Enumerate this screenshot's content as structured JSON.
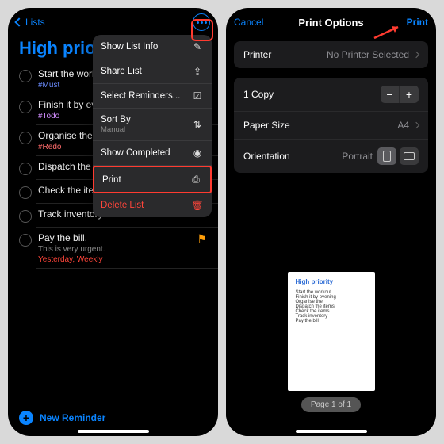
{
  "colors": {
    "accent": "#0a84ff",
    "destructive": "#ff453a",
    "flag": "#ff9f0a"
  },
  "left": {
    "nav": {
      "back": "Lists"
    },
    "list_title": "High priority",
    "reminders": [
      {
        "title": "Start the workout regime.",
        "tag": "#Must",
        "tag_color": "#6b8cff"
      },
      {
        "title": "Finish it by evening.",
        "tag": "#Todo",
        "tag_color": "#d38fff"
      },
      {
        "title": "Organise the drawer.",
        "tag": "#Redo",
        "tag_color": "#ff6b6b"
      },
      {
        "title": "Dispatch the items."
      },
      {
        "title": "Check the items."
      },
      {
        "title": "Track inventory"
      },
      {
        "title": "Pay the bill.",
        "subtitle": "This is very urgent.",
        "date": "Yesterday, Weekly",
        "date_color": "#ff453a",
        "flagged": true
      }
    ],
    "new_reminder": "New Reminder",
    "menu": {
      "show_info": "Show List Info",
      "share": "Share List",
      "select": "Select Reminders...",
      "sort_by": "Sort By",
      "sort_by_sub": "Manual",
      "show_completed": "Show Completed",
      "print": "Print",
      "delete": "Delete List"
    }
  },
  "right": {
    "nav": {
      "cancel": "Cancel",
      "title": "Print Options",
      "print": "Print"
    },
    "printer": {
      "label": "Printer",
      "value": "No Printer Selected"
    },
    "copies": {
      "label": "1 Copy"
    },
    "paper": {
      "label": "Paper Size",
      "value": "A4"
    },
    "orient": {
      "label": "Orientation",
      "value": "Portrait"
    },
    "preview": {
      "title": "High priority",
      "lines": [
        "Start the workout",
        "Finish it by evening",
        "Organise the",
        "Dispatch the items",
        "Check the items",
        "Track inventory",
        "Pay the bill"
      ],
      "pager": "Page 1 of 1"
    }
  }
}
